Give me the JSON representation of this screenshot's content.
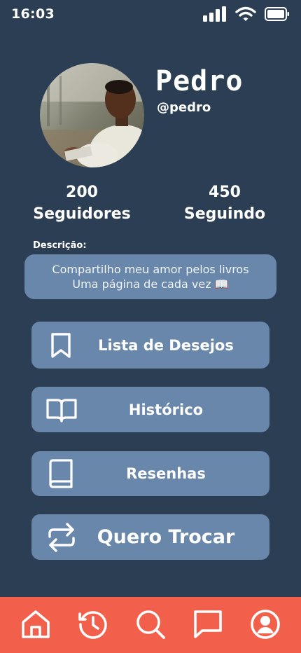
{
  "status_bar": {
    "time": "16:03",
    "icons": [
      "signal-icon",
      "wifi-icon",
      "battery-icon"
    ]
  },
  "profile": {
    "name": "Pedro",
    "handle": "@pedro",
    "followers_count": "200",
    "followers_label": "Seguidores",
    "following_count": "450",
    "following_label": "Seguindo"
  },
  "description": {
    "label": "Descrição:",
    "line1": "Compartilho meu amor pelos livros",
    "line2": "Uma página de cada vez 📖"
  },
  "menu": {
    "wishlist": {
      "label": "Lista de Desejos",
      "icon": "bookmark-icon"
    },
    "history": {
      "label": "Histórico",
      "icon": "open-book-icon"
    },
    "reviews": {
      "label": "Resenhas",
      "icon": "book-icon"
    },
    "trade": {
      "label": "Quero Trocar",
      "icon": "swap-icon"
    }
  },
  "bottom_nav": {
    "items": [
      "home-icon",
      "history-icon",
      "search-icon",
      "chat-icon",
      "profile-icon"
    ]
  },
  "colors": {
    "background": "#2c3e53",
    "button": "#6887aa",
    "nav": "#f2604b",
    "text": "#ffffff"
  }
}
